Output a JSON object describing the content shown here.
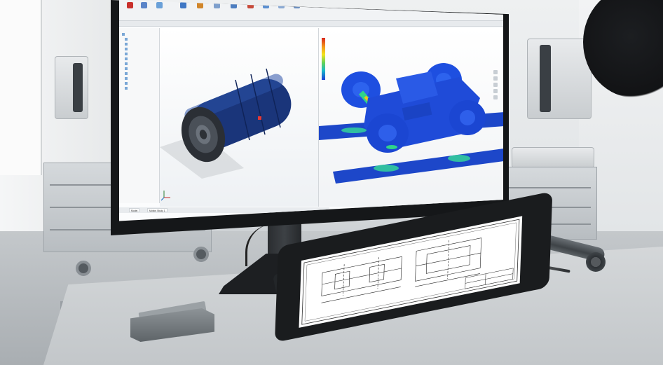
{
  "cad_app": {
    "ribbon_buttons": [
      "",
      "",
      "",
      "",
      "",
      "",
      "",
      "",
      "",
      "",
      ""
    ],
    "command_tabs": [
      "",
      "",
      "",
      "",
      "",
      "",
      ""
    ],
    "feature_tree_items": [
      "",
      "",
      "",
      "",
      "",
      "",
      "",
      "",
      "",
      "",
      "",
      ""
    ],
    "bottom_tabs": [
      "Model",
      "Motion Study 1"
    ],
    "legend_values": [
      "",
      "",
      "",
      "",
      "",
      "",
      "",
      ""
    ]
  },
  "colors": {
    "part_blue": "#1f3f86",
    "fea_blue": "#1a4be0",
    "fea_green": "#2fd48a",
    "fea_red": "#e0261c",
    "monitor_bezel": "#151719",
    "tablet_frame": "#1a1c1e"
  },
  "icons": {
    "triad": "xyz-triad-icon",
    "legend": "fea-legend-icon"
  }
}
